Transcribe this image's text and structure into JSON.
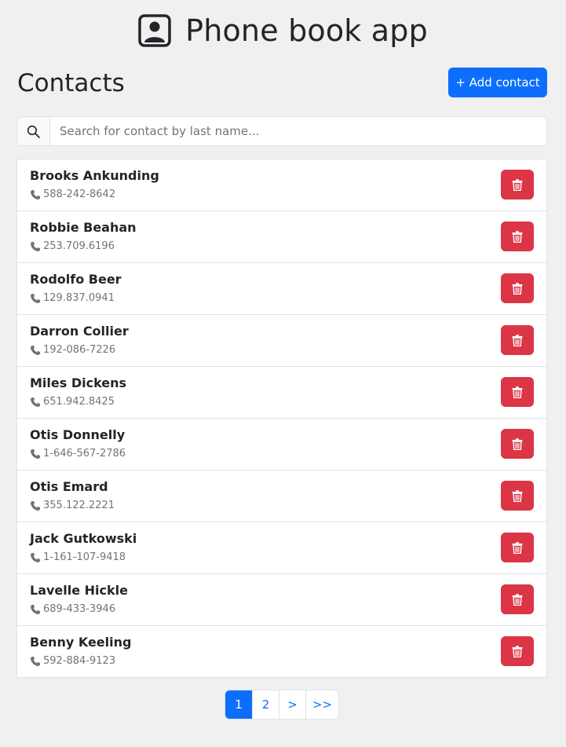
{
  "header": {
    "title": "Phone book app",
    "logo_icon": "person-badge-icon"
  },
  "section": {
    "title": "Contacts",
    "add_button_label": "+ Add contact"
  },
  "search": {
    "placeholder": "Search for contact by last name...",
    "value": "",
    "icon": "search-icon"
  },
  "contacts": [
    {
      "name": "Brooks Ankunding",
      "phone": "588-242-8642"
    },
    {
      "name": "Robbie Beahan",
      "phone": "253.709.6196"
    },
    {
      "name": "Rodolfo Beer",
      "phone": "129.837.0941"
    },
    {
      "name": "Darron Collier",
      "phone": "192-086-7226"
    },
    {
      "name": "Miles Dickens",
      "phone": "651.942.8425"
    },
    {
      "name": "Otis Donnelly",
      "phone": "1-646-567-2786"
    },
    {
      "name": "Otis Emard",
      "phone": "355.122.2221"
    },
    {
      "name": "Jack Gutkowski",
      "phone": "1-161-107-9418"
    },
    {
      "name": "Lavelle Hickle",
      "phone": "689-433-3946"
    },
    {
      "name": "Benny Keeling",
      "phone": "592-884-9123"
    }
  ],
  "pagination": {
    "items": [
      {
        "label": "1",
        "active": true
      },
      {
        "label": "2",
        "active": false
      },
      {
        "label": ">",
        "active": false
      },
      {
        "label": ">>",
        "active": false
      }
    ]
  },
  "colors": {
    "primary": "#0d6efd",
    "danger": "#dc3545",
    "background": "#f0f0f0"
  }
}
